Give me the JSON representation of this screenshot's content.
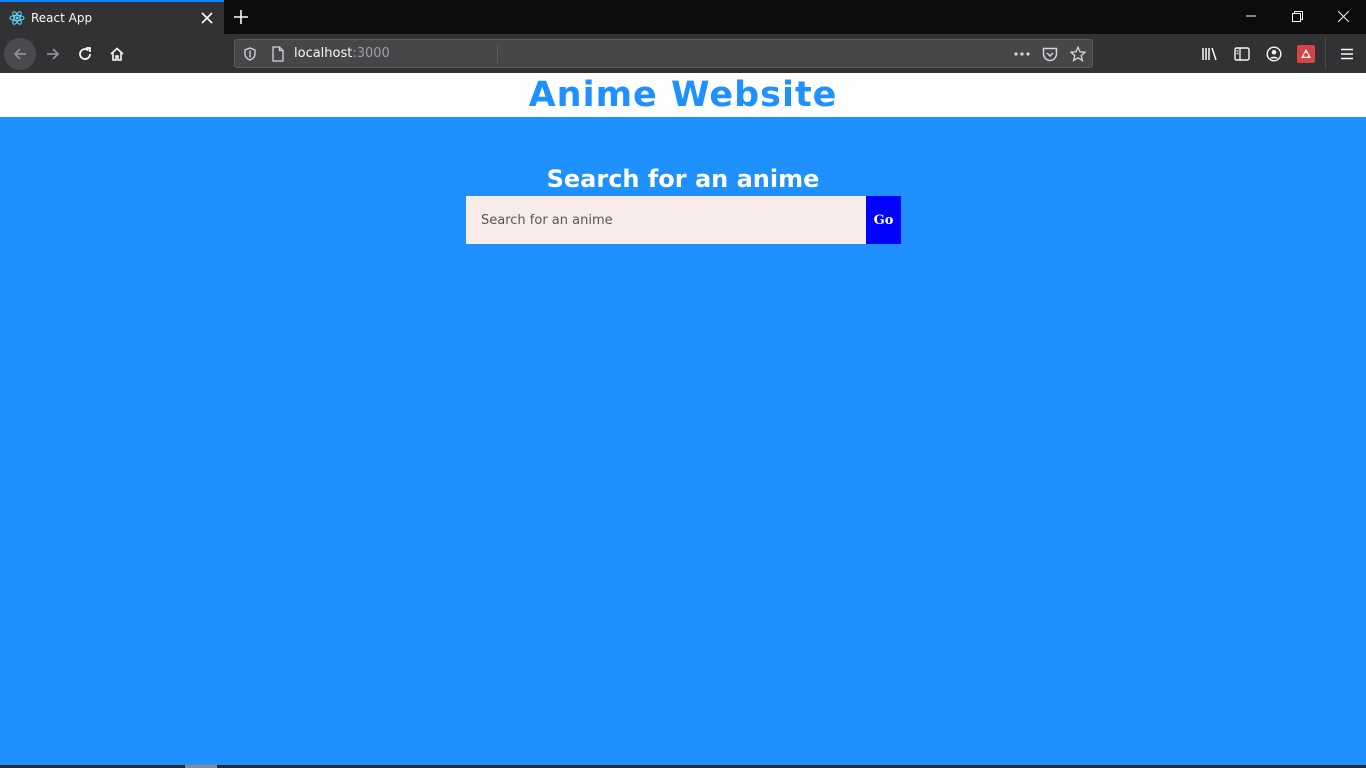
{
  "browser": {
    "tab": {
      "title": "React App"
    },
    "url": {
      "host": "localhost",
      "port": ":3000"
    }
  },
  "page": {
    "site_title": "Anime Website",
    "search_heading": "Search for an anime",
    "search_input": {
      "placeholder": "Search for an anime",
      "value": ""
    },
    "go_button": "Go"
  },
  "colors": {
    "page_background": "#1e90ff",
    "header_background": "#ffffff",
    "title_text": "#1e90ff",
    "input_background": "#f8ecea",
    "go_button_background": "#0000ff",
    "browser_chrome": "#323234",
    "tab_accent": "#0a84ff"
  },
  "icons": {
    "tab": [
      "react-logo-icon",
      "close-icon",
      "plus-icon"
    ],
    "window": [
      "minimize-icon",
      "restore-icon",
      "close-window-icon"
    ],
    "nav": [
      "back-arrow-icon",
      "forward-arrow-icon",
      "reload-icon",
      "home-icon"
    ],
    "urlbar": [
      "shield-icon",
      "page-icon",
      "more-dots-icon",
      "pocket-icon",
      "star-icon"
    ],
    "toolbar": [
      "library-icon",
      "sidebar-icon",
      "account-icon",
      "extension-icon",
      "menu-icon"
    ]
  }
}
